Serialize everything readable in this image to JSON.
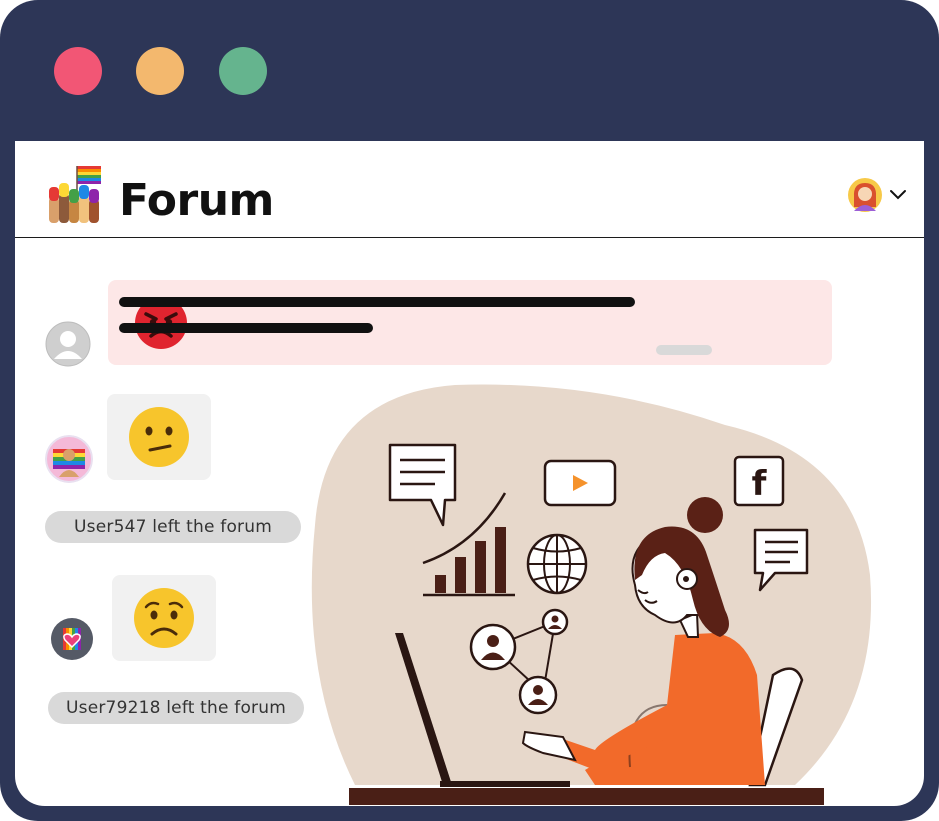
{
  "window": {
    "controls": [
      "close",
      "minimize",
      "maximize"
    ]
  },
  "header": {
    "title": "Forum",
    "logo_icon": "raised-hands-pride-flag-icon",
    "user_icon": "user-avatar-icon",
    "menu_icon": "chevron-down-icon"
  },
  "messages": [
    {
      "type": "post",
      "emoji": "angry-face-icon",
      "avatar": "default-avatar-icon"
    },
    {
      "type": "reaction",
      "emoji": "confused-face-icon",
      "avatar": "pride-avatar-icon"
    },
    {
      "type": "reaction",
      "emoji": "worried-face-icon",
      "avatar": "heart-avatar-icon"
    }
  ],
  "events": [
    {
      "text": "User547 left the forum"
    },
    {
      "text": "User79218 left the forum"
    }
  ],
  "colors": {
    "frame": "#2d3657",
    "close": "#f25675",
    "minimize": "#f3b86e",
    "maximize": "#65b48e",
    "post_bg": "#fde7e7",
    "shape": "#e7d8cb",
    "shirt": "#f26a2a",
    "hair": "#5a2116"
  }
}
